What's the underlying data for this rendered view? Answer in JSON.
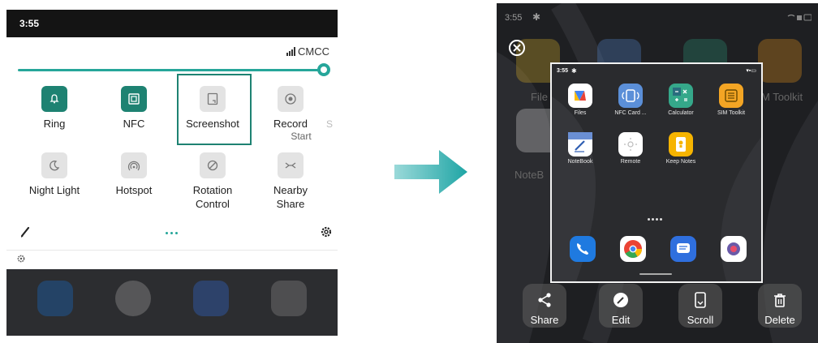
{
  "left": {
    "status_time": "3:55",
    "carrier": "CMCC",
    "tiles_row1": [
      {
        "label": "Ring",
        "icon": "bell-icon",
        "active": true
      },
      {
        "label": "NFC",
        "icon": "nfc-icon",
        "active": true
      },
      {
        "label": "Screenshot",
        "icon": "screenshot-icon",
        "active": false,
        "highlighted": true
      },
      {
        "label": "Record",
        "sublabel": "Start",
        "icon": "record-icon",
        "active": false
      }
    ],
    "tiles_row2": [
      {
        "label": "Night Light",
        "icon": "moon-icon",
        "active": false
      },
      {
        "label": "Hotspot",
        "icon": "hotspot-icon",
        "active": false
      },
      {
        "label": "Rotation Control",
        "icon": "rotation-icon",
        "active": false
      },
      {
        "label": "Nearby Share",
        "icon": "nearby-share-icon",
        "active": false
      }
    ],
    "cut_tile_letter": "S",
    "brightness_level": 1.0
  },
  "right": {
    "status_time": "3:55",
    "bg_labels": {
      "left1": "File",
      "left2": "NoteB",
      "right1": "M Toolkit"
    },
    "screenshot": {
      "status_time": "3:55",
      "apps_row1": [
        {
          "label": "Files",
          "color": "#ffffff"
        },
        {
          "label": "NFC Card ...",
          "color": "#5b8fd8"
        },
        {
          "label": "Calculator",
          "color": "#35a88a"
        },
        {
          "label": "SIM Toolkit",
          "color": "#f3a524"
        }
      ],
      "apps_row2": [
        {
          "label": "NoteBook",
          "color": "#ffffff"
        },
        {
          "label": "Remote",
          "color": "#ffffff"
        },
        {
          "label": "Keep Notes",
          "color": "#f6b400"
        }
      ],
      "dock": [
        "phone-icon",
        "chrome-icon",
        "messages-icon",
        "camera-icon"
      ]
    },
    "actions": [
      {
        "label": "Share",
        "icon": "share-icon"
      },
      {
        "label": "Edit",
        "icon": "edit-icon"
      },
      {
        "label": "Scroll",
        "icon": "scroll-icon"
      },
      {
        "label": "Delete",
        "icon": "delete-icon"
      }
    ]
  },
  "colors": {
    "accent": "#1e8272",
    "arrow": "#2ab0b0"
  }
}
